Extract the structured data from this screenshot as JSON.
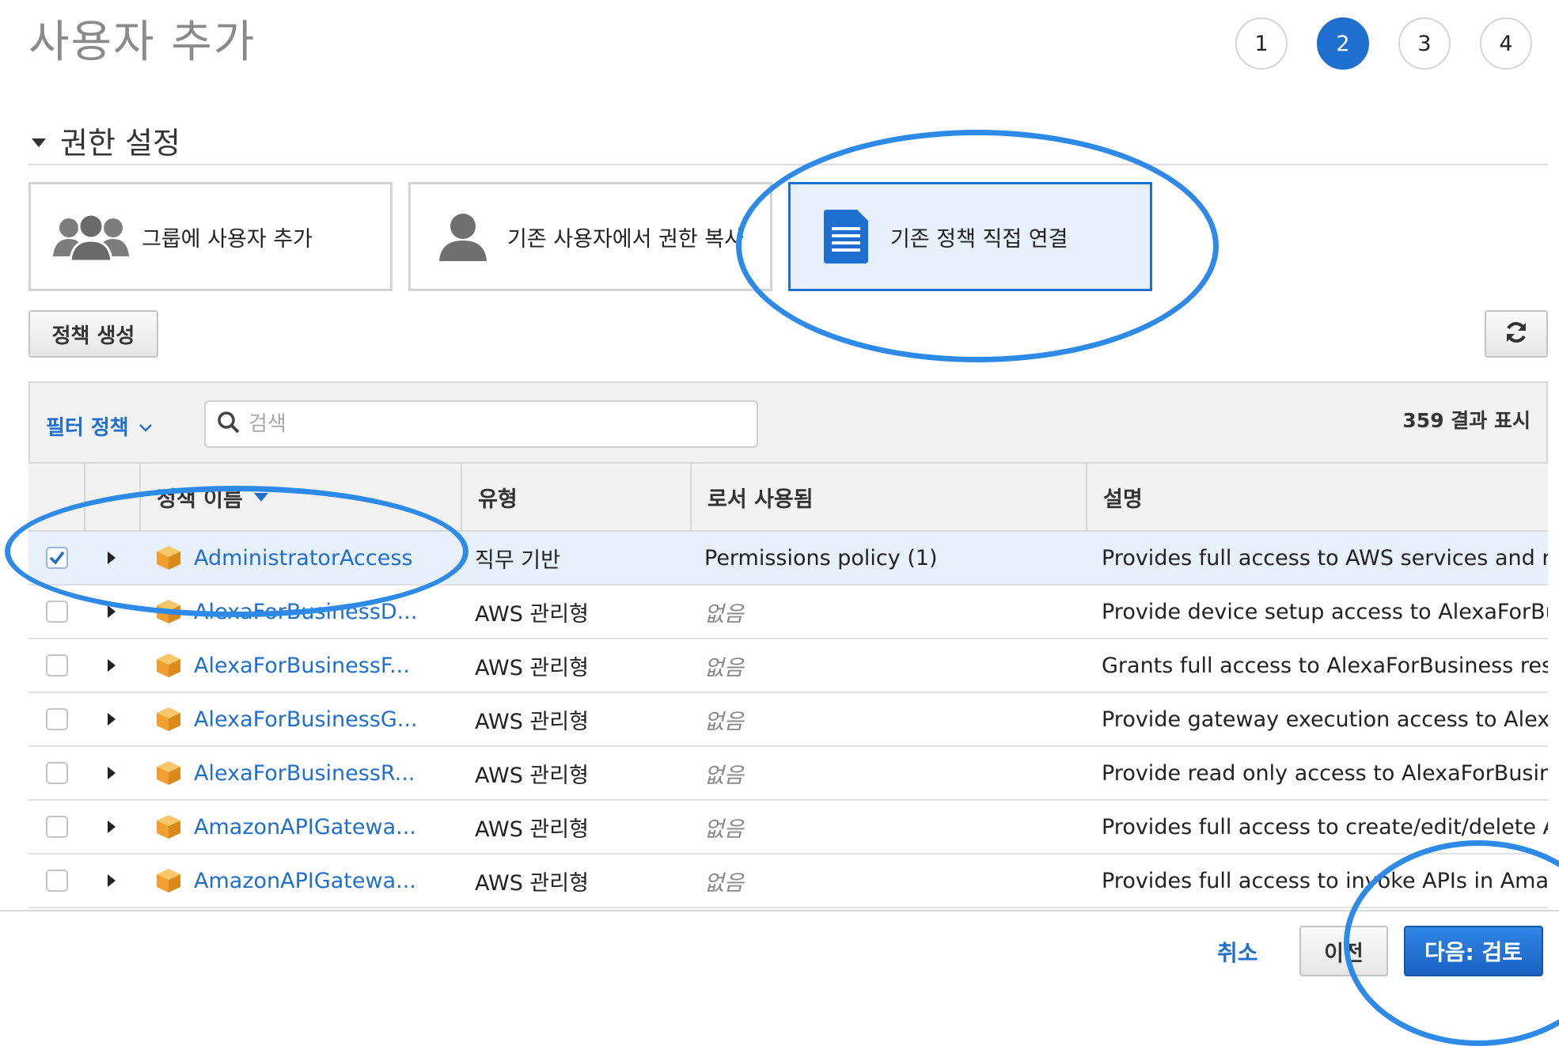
{
  "page": {
    "title": "사용자 추가"
  },
  "steps": [
    "1",
    "2",
    "3",
    "4"
  ],
  "active_step": "2",
  "permissions": {
    "section_title": "권한 설정",
    "options": [
      {
        "label": "그룹에 사용자 추가",
        "icon": "group-icon"
      },
      {
        "label": "기존 사용자에서 권한 복사",
        "icon": "user-icon"
      },
      {
        "label": "기존 정책 직접 연결",
        "icon": "document-icon",
        "selected": true
      }
    ],
    "create_policy_label": "정책 생성"
  },
  "table": {
    "filter_label": "필터 정책",
    "search_placeholder": "검색",
    "results_text": "359 결과 표시",
    "columns": {
      "name": "정책 이름",
      "type": "유형",
      "used_as": "로서 사용됨",
      "description": "설명"
    },
    "rows": [
      {
        "checked": true,
        "name": "AdministratorAccess",
        "type": "직무 기반",
        "used_as": "Permissions policy (1)",
        "description": "Provides full access to AWS services and re..."
      },
      {
        "checked": false,
        "name": "AlexaForBusinessD...",
        "type": "AWS 관리형",
        "used_as": "없음",
        "description": "Provide device setup access to AlexaForBu..."
      },
      {
        "checked": false,
        "name": "AlexaForBusinessF...",
        "type": "AWS 관리형",
        "used_as": "없음",
        "description": "Grants full access to AlexaForBusiness reso..."
      },
      {
        "checked": false,
        "name": "AlexaForBusinessG...",
        "type": "AWS 관리형",
        "used_as": "없음",
        "description": "Provide gateway execution access to Alexa..."
      },
      {
        "checked": false,
        "name": "AlexaForBusinessR...",
        "type": "AWS 관리형",
        "used_as": "없음",
        "description": "Provide read only access to AlexaForBusine..."
      },
      {
        "checked": false,
        "name": "AmazonAPIGatewa...",
        "type": "AWS 관리형",
        "used_as": "없음",
        "description": "Provides full access to create/edit/delete A..."
      },
      {
        "checked": false,
        "name": "AmazonAPIGatewa...",
        "type": "AWS 관리형",
        "used_as": "없음",
        "description": "Provides full access to invoke APIs in Amaz..."
      }
    ]
  },
  "footer": {
    "cancel_label": "취소",
    "previous_label": "이전",
    "next_label": "다음: 검토"
  },
  "colors": {
    "accent": "#1f6fd0",
    "annotation": "#2d8ae8",
    "policy_icon": "#f0a030"
  }
}
